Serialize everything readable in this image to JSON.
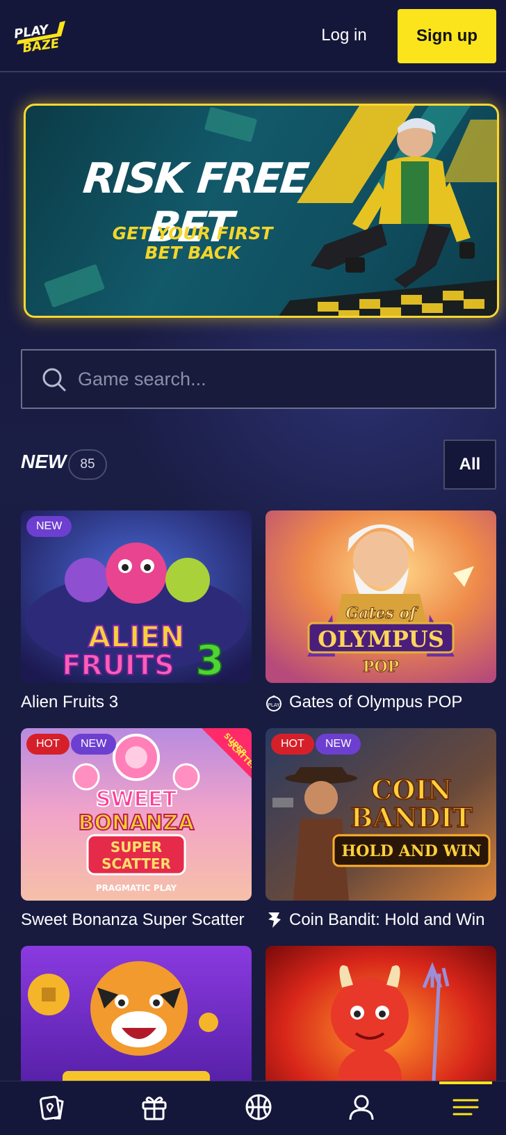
{
  "header": {
    "logo_text": "PLAY BAZE",
    "login_label": "Log in",
    "signup_label": "Sign up"
  },
  "banner": {
    "title": "RISK FREE BET",
    "subtitle_line1": "GET YOUR FIRST",
    "subtitle_line2": "BET BACK"
  },
  "search": {
    "placeholder": "Game search..."
  },
  "section": {
    "title": "NEW",
    "count": "85",
    "all_label": "All"
  },
  "games": [
    {
      "title": "Alien Fruits 3",
      "badges": [
        "NEW"
      ],
      "thumb_text": "ALIEN FRUITS 3"
    },
    {
      "title": "Gates of Olympus POP",
      "badges": [],
      "thumb_text": "Gates of OLYMPUS POP"
    },
    {
      "title": "Sweet Bonanza Super Scatter",
      "badges": [
        "HOT",
        "NEW"
      ],
      "thumb_text": "SWEET BONANZA SUPER SCATTER",
      "ribbon": "SUPER SCATTER",
      "provider": "PRAGMATIC PLAY"
    },
    {
      "title": "Coin Bandit: Hold and Win",
      "badges": [
        "HOT",
        "NEW"
      ],
      "thumb_text": "COIN BANDIT HOLD AND WIN"
    },
    {
      "title": "",
      "badges": [],
      "thumb_text": ""
    },
    {
      "title": "",
      "badges": [],
      "thumb_text": ""
    }
  ],
  "colors": {
    "accent": "#fbe41c",
    "background": "#16193a",
    "badge_new": "#6d3fd0",
    "badge_hot": "#d5202a"
  },
  "bottom_nav": {
    "items": [
      "casino-icon",
      "gift-icon",
      "sports-ball-icon",
      "user-icon",
      "menu-icon"
    ],
    "active": "menu-icon"
  }
}
